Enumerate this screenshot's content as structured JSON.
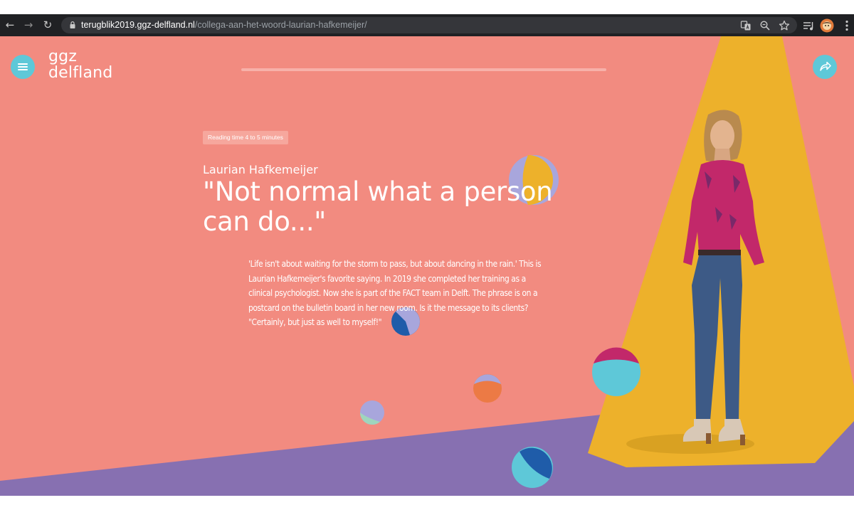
{
  "browser": {
    "url_host": "terugblik2019.ggz-delfland.nl",
    "url_path": "/collega-aan-het-woord-laurian-hafkemeijer/",
    "icons": [
      "back-arrow-icon",
      "forward-arrow-icon",
      "reload-icon",
      "lock-icon",
      "translate-icon",
      "zoom-icon",
      "star-icon",
      "reading-list-icon",
      "profile-avatar",
      "more-menu-icon"
    ]
  },
  "site": {
    "logo_line1": "ggz",
    "logo_line2": "delfland",
    "menu_icon": "hamburger-icon",
    "share_icon": "share-arrow-icon"
  },
  "article": {
    "reading_time": "Reading time 4 to 5 minutes",
    "name": "Laurian Hafkemeijer",
    "title_line1": "\"Not normal what a person",
    "title_line2": "can do...\"",
    "intro_lines": [
      "'Life isn't about waiting for the storm to pass, but about dancing in the rain.' This is",
      "Laurian Hafkemeijer's favorite saying. In 2019 she completed her training as a",
      "clinical psychologist. Now she is part of the FACT team in Delft. The phrase is on a",
      "postcard on the bulletin board in her new room. Is it the message to its clients?",
      "\"Certainly, but just as well to myself!\""
    ]
  },
  "colors": {
    "coral": "#f28b80",
    "purple": "#8770b1",
    "spotlight_yellow": "#edb12b",
    "cyan": "#5ec8d8",
    "dark_blue": "#1f5ca9",
    "magenta": "#c2286a",
    "lavender": "#a8a6dc",
    "orange": "#ec7a45",
    "mint": "#9fd5bd"
  }
}
